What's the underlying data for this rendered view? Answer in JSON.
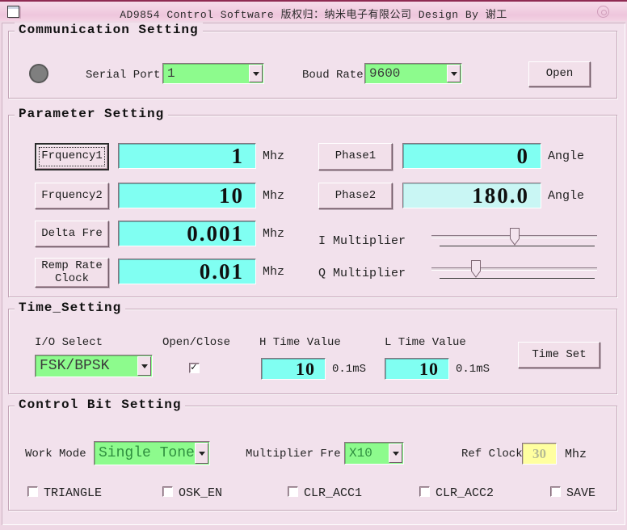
{
  "titlebar": {
    "title": "AD9854 Control Software  版权归：纳米电子有限公司  Design By 谢工"
  },
  "communication": {
    "title": "Communication Setting",
    "indicator_status_color": "#7f7f7f",
    "serial_port_label": "Serial Port",
    "serial_port_value": "1",
    "baud_rate_label": "Boud Rate",
    "baud_rate_value": "9600",
    "open_button": "Open"
  },
  "parameter": {
    "title": "Parameter Setting",
    "freq_rows": [
      {
        "button": "Frquency1",
        "value": "1",
        "unit": "Mhz"
      },
      {
        "button": "Frquency2",
        "value": "10",
        "unit": "Mhz"
      },
      {
        "button": "Delta Fre",
        "value": "0.001",
        "unit": "Mhz"
      },
      {
        "button": "Remp Rate Clock",
        "value": "0.01",
        "unit": "Mhz"
      }
    ],
    "phase_rows": [
      {
        "button": "Phase1",
        "value": "0",
        "unit": "Angle"
      },
      {
        "button": "Phase2",
        "value": "180.0",
        "unit": "Angle"
      }
    ],
    "sliders": [
      {
        "label": "I Multiplier",
        "position_percent": 50
      },
      {
        "label": "Q Multiplier",
        "position_percent": 27
      }
    ]
  },
  "time_setting": {
    "title": "Time_Setting",
    "io_select_label": "I/O Select",
    "io_select_value": "FSK/BPSK",
    "open_close_label": "Open/Close",
    "open_close_checked": true,
    "h_time_label": "H Time Value",
    "h_time_value": "10",
    "h_time_unit": "0.1mS",
    "l_time_label": "L Time Value",
    "l_time_value": "10",
    "l_time_unit": "0.1mS",
    "time_set_button": "Time Set"
  },
  "control_bit": {
    "title": "Control Bit Setting",
    "work_mode_label": "Work Mode",
    "work_mode_value": "Single Tone",
    "multiplier_fre_label": "Multiplier Fre",
    "multiplier_fre_value": "X10",
    "ref_clock_label": "Ref Clock",
    "ref_clock_value": "30",
    "ref_clock_unit": "Mhz",
    "checkboxes": [
      {
        "label": "TRIANGLE",
        "checked": false
      },
      {
        "label": "OSK_EN",
        "checked": false
      },
      {
        "label": "CLR_ACC1",
        "checked": false
      },
      {
        "label": "CLR_ACC2",
        "checked": false
      },
      {
        "label": "SAVE",
        "checked": false
      }
    ]
  },
  "icons": {
    "form_icon": "window-page glyph",
    "titlebar_circle_icon": "concentric circle",
    "dropdown_arrow_icon": "▼",
    "check_icon": "✓",
    "slider_thumb_icon": "pointer pentagon"
  },
  "colors": {
    "field_cyan": "#80fff2",
    "field_pale_cyan": "#c9f6f4",
    "combo_green": "#8dfb8d",
    "ref_clock_yellow": "#ffffa0",
    "window_pink": "#f2e1ec",
    "titlebar_stripe": "#8f2a52",
    "combo_green_text": "#2f8f3f"
  }
}
